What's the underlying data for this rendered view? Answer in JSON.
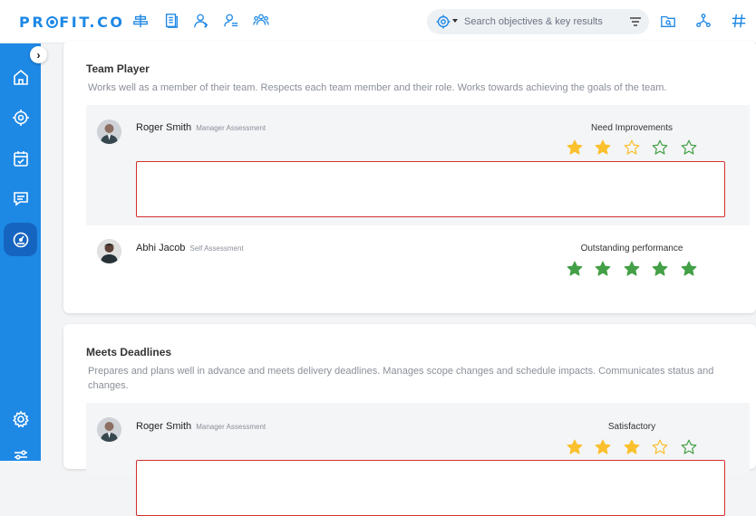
{
  "app": {
    "logo_pre": "PR",
    "logo_post": "FIT.CO"
  },
  "search": {
    "placeholder": "Search objectives & key results"
  },
  "colors": {
    "brand": "#1e88e5",
    "star_yellow": "#fbc02d",
    "star_green": "#43a047",
    "star_empty_yellow": "#fbc02d",
    "error_border": "#d32f2f"
  },
  "sections": [
    {
      "title": "Team Player",
      "description": "Works well as a member of their team. Respects each team member and their role. Works towards achieving the goals of the team.",
      "assessments": [
        {
          "name": "Roger Smith",
          "role": "Manager Assessment",
          "rating_label": "Need Improvements",
          "rating": 2,
          "max": 5,
          "color": "yellow"
        },
        {
          "name": "Abhi Jacob",
          "role": "Self Assessment",
          "rating_label": "Outstanding performance",
          "rating": 5,
          "max": 5,
          "color": "green"
        }
      ]
    },
    {
      "title": "Meets Deadlines",
      "description": "Prepares and plans well in advance and meets delivery deadlines. Manages scope changes and schedule impacts. Communicates status and changes.",
      "assessments": [
        {
          "name": "Roger Smith",
          "role": "Manager Assessment",
          "rating_label": "Satisfactory",
          "rating": 3,
          "max": 5,
          "color": "yellow"
        }
      ]
    }
  ]
}
